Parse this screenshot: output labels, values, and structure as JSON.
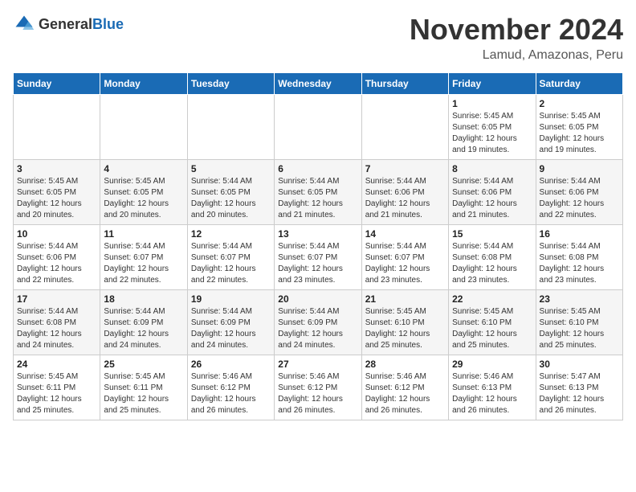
{
  "header": {
    "logo": {
      "general": "General",
      "blue": "Blue"
    },
    "title": "November 2024",
    "location": "Lamud, Amazonas, Peru"
  },
  "weekdays": [
    "Sunday",
    "Monday",
    "Tuesday",
    "Wednesday",
    "Thursday",
    "Friday",
    "Saturday"
  ],
  "weeks": [
    [
      {
        "day": "",
        "info": ""
      },
      {
        "day": "",
        "info": ""
      },
      {
        "day": "",
        "info": ""
      },
      {
        "day": "",
        "info": ""
      },
      {
        "day": "",
        "info": ""
      },
      {
        "day": "1",
        "info": "Sunrise: 5:45 AM\nSunset: 6:05 PM\nDaylight: 12 hours and 19 minutes."
      },
      {
        "day": "2",
        "info": "Sunrise: 5:45 AM\nSunset: 6:05 PM\nDaylight: 12 hours and 19 minutes."
      }
    ],
    [
      {
        "day": "3",
        "info": "Sunrise: 5:45 AM\nSunset: 6:05 PM\nDaylight: 12 hours and 20 minutes."
      },
      {
        "day": "4",
        "info": "Sunrise: 5:45 AM\nSunset: 6:05 PM\nDaylight: 12 hours and 20 minutes."
      },
      {
        "day": "5",
        "info": "Sunrise: 5:44 AM\nSunset: 6:05 PM\nDaylight: 12 hours and 20 minutes."
      },
      {
        "day": "6",
        "info": "Sunrise: 5:44 AM\nSunset: 6:05 PM\nDaylight: 12 hours and 21 minutes."
      },
      {
        "day": "7",
        "info": "Sunrise: 5:44 AM\nSunset: 6:06 PM\nDaylight: 12 hours and 21 minutes."
      },
      {
        "day": "8",
        "info": "Sunrise: 5:44 AM\nSunset: 6:06 PM\nDaylight: 12 hours and 21 minutes."
      },
      {
        "day": "9",
        "info": "Sunrise: 5:44 AM\nSunset: 6:06 PM\nDaylight: 12 hours and 22 minutes."
      }
    ],
    [
      {
        "day": "10",
        "info": "Sunrise: 5:44 AM\nSunset: 6:06 PM\nDaylight: 12 hours and 22 minutes."
      },
      {
        "day": "11",
        "info": "Sunrise: 5:44 AM\nSunset: 6:07 PM\nDaylight: 12 hours and 22 minutes."
      },
      {
        "day": "12",
        "info": "Sunrise: 5:44 AM\nSunset: 6:07 PM\nDaylight: 12 hours and 22 minutes."
      },
      {
        "day": "13",
        "info": "Sunrise: 5:44 AM\nSunset: 6:07 PM\nDaylight: 12 hours and 23 minutes."
      },
      {
        "day": "14",
        "info": "Sunrise: 5:44 AM\nSunset: 6:07 PM\nDaylight: 12 hours and 23 minutes."
      },
      {
        "day": "15",
        "info": "Sunrise: 5:44 AM\nSunset: 6:08 PM\nDaylight: 12 hours and 23 minutes."
      },
      {
        "day": "16",
        "info": "Sunrise: 5:44 AM\nSunset: 6:08 PM\nDaylight: 12 hours and 23 minutes."
      }
    ],
    [
      {
        "day": "17",
        "info": "Sunrise: 5:44 AM\nSunset: 6:08 PM\nDaylight: 12 hours and 24 minutes."
      },
      {
        "day": "18",
        "info": "Sunrise: 5:44 AM\nSunset: 6:09 PM\nDaylight: 12 hours and 24 minutes."
      },
      {
        "day": "19",
        "info": "Sunrise: 5:44 AM\nSunset: 6:09 PM\nDaylight: 12 hours and 24 minutes."
      },
      {
        "day": "20",
        "info": "Sunrise: 5:44 AM\nSunset: 6:09 PM\nDaylight: 12 hours and 24 minutes."
      },
      {
        "day": "21",
        "info": "Sunrise: 5:45 AM\nSunset: 6:10 PM\nDaylight: 12 hours and 25 minutes."
      },
      {
        "day": "22",
        "info": "Sunrise: 5:45 AM\nSunset: 6:10 PM\nDaylight: 12 hours and 25 minutes."
      },
      {
        "day": "23",
        "info": "Sunrise: 5:45 AM\nSunset: 6:10 PM\nDaylight: 12 hours and 25 minutes."
      }
    ],
    [
      {
        "day": "24",
        "info": "Sunrise: 5:45 AM\nSunset: 6:11 PM\nDaylight: 12 hours and 25 minutes."
      },
      {
        "day": "25",
        "info": "Sunrise: 5:45 AM\nSunset: 6:11 PM\nDaylight: 12 hours and 25 minutes."
      },
      {
        "day": "26",
        "info": "Sunrise: 5:46 AM\nSunset: 6:12 PM\nDaylight: 12 hours and 26 minutes."
      },
      {
        "day": "27",
        "info": "Sunrise: 5:46 AM\nSunset: 6:12 PM\nDaylight: 12 hours and 26 minutes."
      },
      {
        "day": "28",
        "info": "Sunrise: 5:46 AM\nSunset: 6:12 PM\nDaylight: 12 hours and 26 minutes."
      },
      {
        "day": "29",
        "info": "Sunrise: 5:46 AM\nSunset: 6:13 PM\nDaylight: 12 hours and 26 minutes."
      },
      {
        "day": "30",
        "info": "Sunrise: 5:47 AM\nSunset: 6:13 PM\nDaylight: 12 hours and 26 minutes."
      }
    ]
  ]
}
